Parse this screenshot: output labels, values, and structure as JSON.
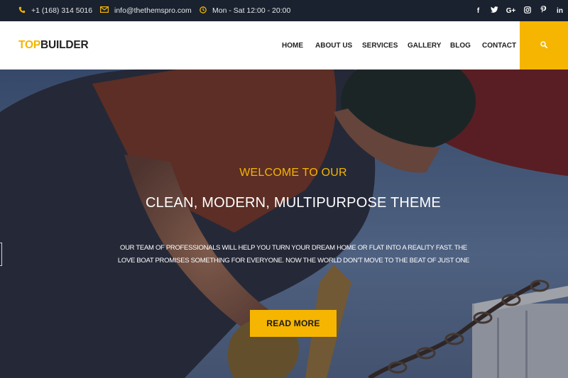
{
  "topbar": {
    "phone": "+1 (168) 314 5016",
    "email": "info@thethemspro.com",
    "hours": "Mon - Sat 12:00 - 20:00",
    "social": [
      "f",
      "t",
      "G+",
      "ig",
      "p",
      "in"
    ]
  },
  "header": {
    "logo_a": "TOP",
    "logo_b": "BUILDER",
    "nav": [
      "HOME",
      "ABOUT US",
      "SERVICES",
      "GALLERY",
      "BLOG",
      "CONTACT"
    ]
  },
  "hero": {
    "welcome": "WELCOME TO OUR",
    "headline": "CLEAN, MODERN, MULTIPURPOSE THEME",
    "desc_line1": "OUR TEAM OF PROFESSIONALS WILL HELP YOU TURN YOUR DREAM HOME OR FLAT INTO A REALITY FAST. THE",
    "desc_line2": "LOVE BOAT PROMISES SOMETHING FOR EVERYONE. NOW THE WORLD DON'T MOVE TO THE BEAT OF JUST ONE",
    "button": "READ MORE"
  },
  "colors": {
    "accent": "#f5b500",
    "topbar": "#1a2230"
  }
}
